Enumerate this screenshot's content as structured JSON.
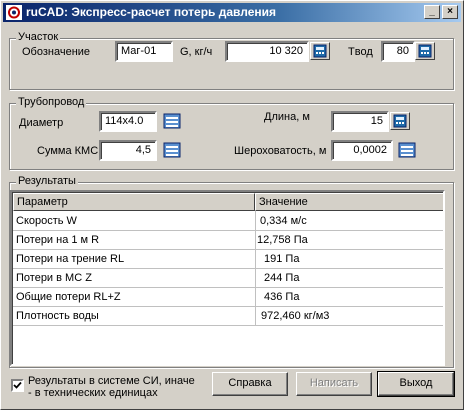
{
  "window": {
    "title": "ruCAD: Экспресс-расчет потерь давления",
    "controls": [
      "minimize-icon",
      "close-icon"
    ]
  },
  "section": {
    "title": "Участок",
    "designation_label": "Обозначение",
    "designation_value": "Маг-01",
    "flow_label": "G, кг/ч",
    "flow_value": "10 320",
    "temp_label": "Tвод",
    "temp_value": "80"
  },
  "pipeline": {
    "title": "Трубопровод",
    "diameter_label": "Диаметр",
    "diameter_value": "114x4.0",
    "length_label": "Длина, м",
    "length_value": "15",
    "kms_label": "Сумма КМС",
    "kms_value": "4,5",
    "roughness_label": "Шероховатость, м",
    "roughness_value": "0,0002"
  },
  "results": {
    "title": "Результаты",
    "columns": [
      "Параметр",
      "Значение"
    ],
    "rows": [
      [
        "Скорость W",
        "0,334 м/с"
      ],
      [
        "Потери на 1 м R",
        "12,758 Па"
      ],
      [
        "Потери на трение RL",
        "191 Па"
      ],
      [
        "Потери в МС Z",
        "244 Па"
      ],
      [
        "Общие потери RL+Z",
        "436 Па"
      ],
      [
        "Плотность воды",
        "972,460 кг/м3"
      ]
    ]
  },
  "footer": {
    "si_checked": true,
    "si_label_line1": "Результаты в системе СИ, иначе",
    "si_label_line2": "- в технических единицах",
    "help_button": "Справка",
    "write_button": "Написать",
    "exit_button": "Выход"
  },
  "colors": {
    "titlebar_start": "#0a246a",
    "titlebar_end": "#a6caf0",
    "window_bg": "#d4d0c8"
  }
}
